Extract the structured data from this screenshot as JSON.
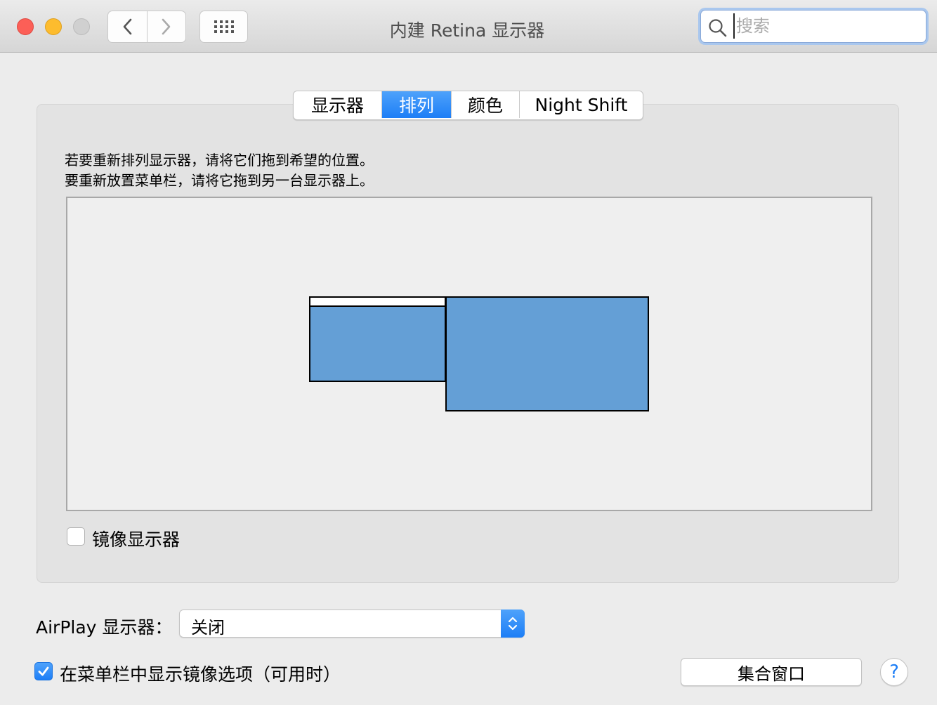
{
  "window": {
    "title": "内建 Retina 显示器",
    "search_placeholder": "搜索"
  },
  "tabs": [
    {
      "label": "显示器",
      "active": false
    },
    {
      "label": "排列",
      "active": true
    },
    {
      "label": "颜色",
      "active": false
    },
    {
      "label": "Night Shift",
      "active": false
    }
  ],
  "arrangement": {
    "instruction_line1": "若要重新排列显示器，请将它们拖到希望的位置。",
    "instruction_line2": "要重新放置菜单栏，请将它拖到另一台显示器上。",
    "display_color": "#649fd6"
  },
  "mirror": {
    "label": "镜像显示器",
    "checked": false
  },
  "airplay": {
    "label": "AirPlay 显示器：",
    "value": "关闭"
  },
  "show_mirroring": {
    "label": "在菜单栏中显示镜像选项（可用时）",
    "checked": true
  },
  "buttons": {
    "gather_windows": "集合窗口",
    "help": "?"
  },
  "colors": {
    "accent": "#1d7ef6",
    "close": "#fc5f57",
    "minimize": "#fdbc2e",
    "zoom_disabled": "#d0d0d0"
  }
}
